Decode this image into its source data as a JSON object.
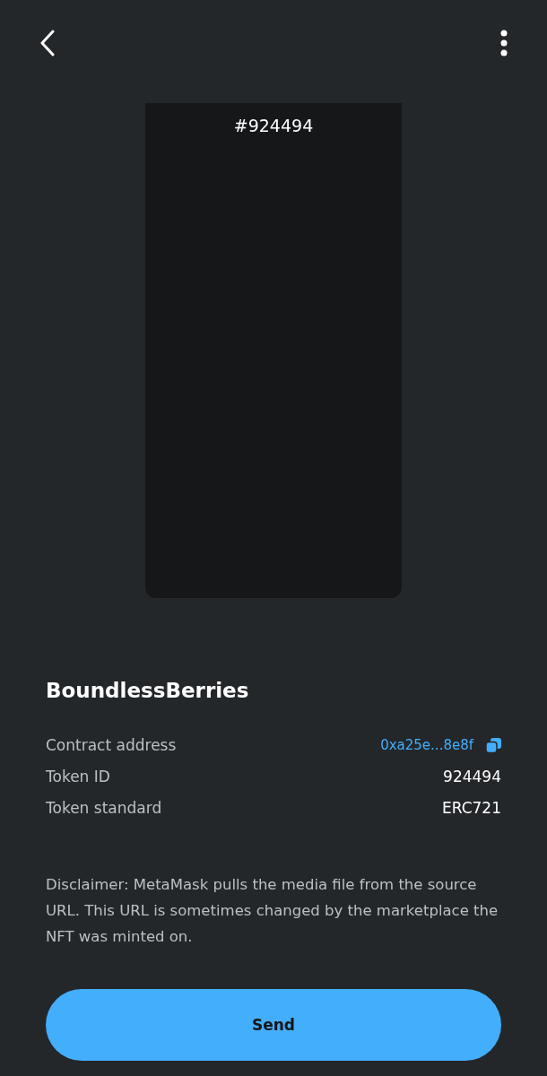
{
  "nft_image": {
    "label": "#924494"
  },
  "title": "BoundlessBerries",
  "details": [
    {
      "label": "Contract address",
      "value": "0xa25e...8e8f",
      "kind": "link"
    },
    {
      "label": "Token ID",
      "value": "924494",
      "kind": "text"
    },
    {
      "label": "Token standard",
      "value": "ERC721",
      "kind": "text"
    }
  ],
  "disclaimer": "Disclaimer: MetaMask pulls the media file from the source URL. This URL is sometimes changed by the marketplace the NFT was minted on.",
  "primary_button": "Send"
}
